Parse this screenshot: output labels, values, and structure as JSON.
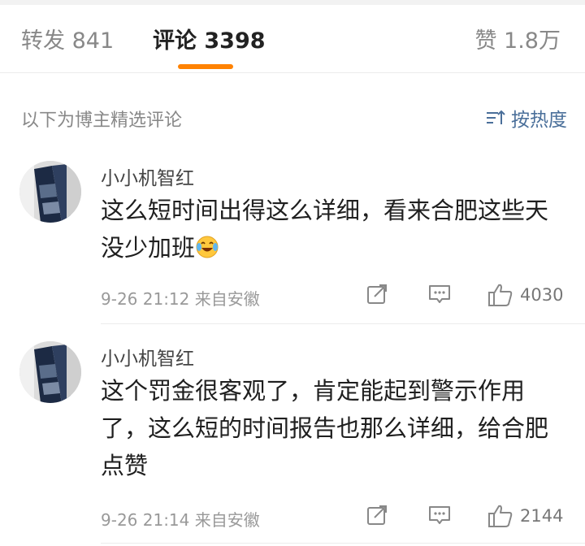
{
  "tabs": {
    "repost": "转发 841",
    "comment": "评论 3398",
    "like": "赞 1.8万"
  },
  "filter": {
    "label": "以下为博主精选评论",
    "sort_label": "按热度"
  },
  "icons": {
    "sort": "sort-icon",
    "share": "share-icon",
    "reply": "reply-icon",
    "like": "thumbs-up-icon",
    "emoji": "laughing-tears-emoji"
  },
  "colors": {
    "accent": "#ff8200",
    "link": "#4a6f9a",
    "muted": "#999999"
  },
  "comments": [
    {
      "user": "小小机智红",
      "text": "这么短时间出得这么详细，看来合肥这些天没少加班",
      "meta": "9-26 21:12  来自安徽",
      "likes": "4030"
    },
    {
      "user": "小小机智红",
      "text": "这个罚金很客观了，肯定能起到警示作用了，这么短的时间报告也那么详细，给合肥点赞",
      "meta": "9-26 21:14  来自安徽",
      "likes": "2144"
    }
  ]
}
